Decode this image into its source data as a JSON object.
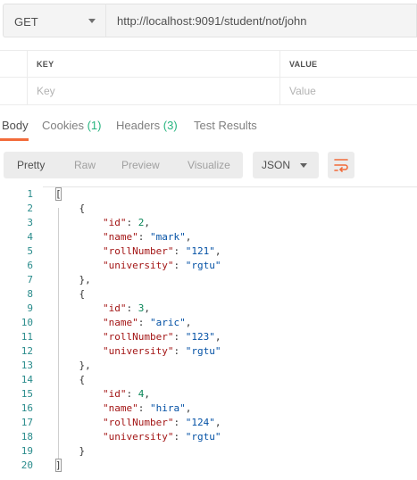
{
  "request": {
    "method": "GET",
    "url": "http://localhost:9091/student/not/john"
  },
  "params": {
    "key_header": "KEY",
    "value_header": "VALUE",
    "key_placeholder": "Key",
    "value_placeholder": "Value"
  },
  "response_tabs": {
    "body": "Body",
    "cookies": "Cookies",
    "cookies_count": "(1)",
    "headers": "Headers",
    "headers_count": "(3)",
    "test_results": "Test Results"
  },
  "toolbar": {
    "pretty": "Pretty",
    "raw": "Raw",
    "preview": "Preview",
    "visualize": "Visualize",
    "format": "JSON"
  },
  "colors": {
    "accent": "#f26b3a",
    "count": "#26b47f",
    "json_key": "#a31515",
    "json_string": "#0451a5",
    "json_number": "#098658"
  },
  "response_lines": [
    {
      "num": "1",
      "parts": [
        [
          "p",
          "["
        ]
      ]
    },
    {
      "num": "2",
      "parts": [
        [
          "p",
          "    {"
        ]
      ]
    },
    {
      "num": "3",
      "parts": [
        [
          "p",
          "        "
        ],
        [
          "k",
          "\"id\""
        ],
        [
          "p",
          ": "
        ],
        [
          "n",
          "2"
        ],
        [
          "p",
          ","
        ]
      ]
    },
    {
      "num": "4",
      "parts": [
        [
          "p",
          "        "
        ],
        [
          "k",
          "\"name\""
        ],
        [
          "p",
          ": "
        ],
        [
          "s",
          "\"mark\""
        ],
        [
          "p",
          ","
        ]
      ]
    },
    {
      "num": "5",
      "parts": [
        [
          "p",
          "        "
        ],
        [
          "k",
          "\"rollNumber\""
        ],
        [
          "p",
          ": "
        ],
        [
          "s",
          "\"121\""
        ],
        [
          "p",
          ","
        ]
      ]
    },
    {
      "num": "6",
      "parts": [
        [
          "p",
          "        "
        ],
        [
          "k",
          "\"university\""
        ],
        [
          "p",
          ": "
        ],
        [
          "s",
          "\"rgtu\""
        ]
      ]
    },
    {
      "num": "7",
      "parts": [
        [
          "p",
          "    },"
        ]
      ]
    },
    {
      "num": "8",
      "parts": [
        [
          "p",
          "    {"
        ]
      ]
    },
    {
      "num": "9",
      "parts": [
        [
          "p",
          "        "
        ],
        [
          "k",
          "\"id\""
        ],
        [
          "p",
          ": "
        ],
        [
          "n",
          "3"
        ],
        [
          "p",
          ","
        ]
      ]
    },
    {
      "num": "10",
      "parts": [
        [
          "p",
          "        "
        ],
        [
          "k",
          "\"name\""
        ],
        [
          "p",
          ": "
        ],
        [
          "s",
          "\"aric\""
        ],
        [
          "p",
          ","
        ]
      ]
    },
    {
      "num": "11",
      "parts": [
        [
          "p",
          "        "
        ],
        [
          "k",
          "\"rollNumber\""
        ],
        [
          "p",
          ": "
        ],
        [
          "s",
          "\"123\""
        ],
        [
          "p",
          ","
        ]
      ]
    },
    {
      "num": "12",
      "parts": [
        [
          "p",
          "        "
        ],
        [
          "k",
          "\"university\""
        ],
        [
          "p",
          ": "
        ],
        [
          "s",
          "\"rgtu\""
        ]
      ]
    },
    {
      "num": "13",
      "parts": [
        [
          "p",
          "    },"
        ]
      ]
    },
    {
      "num": "14",
      "parts": [
        [
          "p",
          "    {"
        ]
      ]
    },
    {
      "num": "15",
      "parts": [
        [
          "p",
          "        "
        ],
        [
          "k",
          "\"id\""
        ],
        [
          "p",
          ": "
        ],
        [
          "n",
          "4"
        ],
        [
          "p",
          ","
        ]
      ]
    },
    {
      "num": "16",
      "parts": [
        [
          "p",
          "        "
        ],
        [
          "k",
          "\"name\""
        ],
        [
          "p",
          ": "
        ],
        [
          "s",
          "\"hira\""
        ],
        [
          "p",
          ","
        ]
      ]
    },
    {
      "num": "17",
      "parts": [
        [
          "p",
          "        "
        ],
        [
          "k",
          "\"rollNumber\""
        ],
        [
          "p",
          ": "
        ],
        [
          "s",
          "\"124\""
        ],
        [
          "p",
          ","
        ]
      ]
    },
    {
      "num": "18",
      "parts": [
        [
          "p",
          "        "
        ],
        [
          "k",
          "\"university\""
        ],
        [
          "p",
          ": "
        ],
        [
          "s",
          "\"rgtu\""
        ]
      ]
    },
    {
      "num": "19",
      "parts": [
        [
          "p",
          "    }"
        ]
      ]
    },
    {
      "num": "20",
      "parts": [
        [
          "p",
          "]"
        ]
      ]
    }
  ]
}
